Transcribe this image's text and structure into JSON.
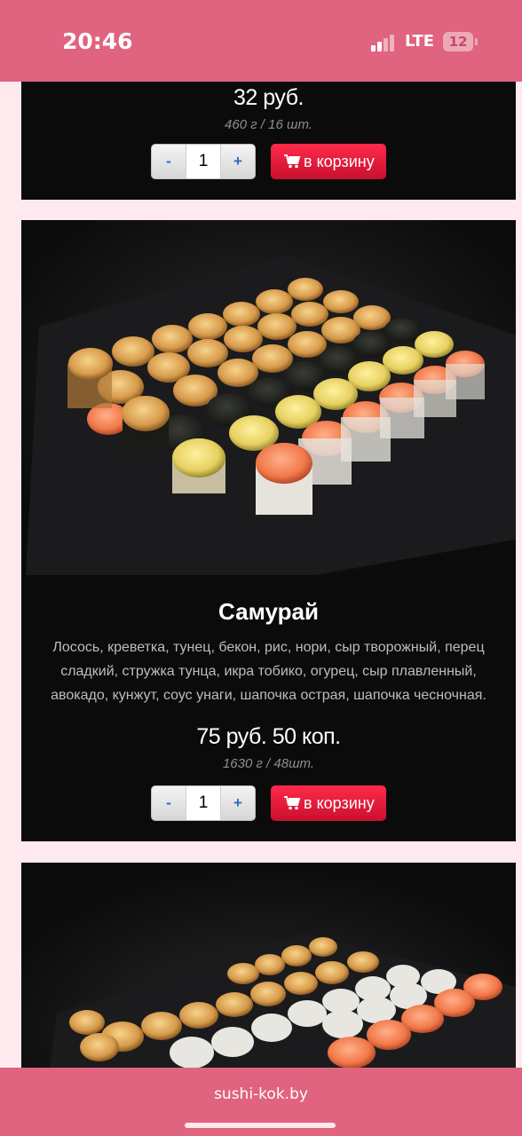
{
  "status": {
    "time": "20:46",
    "network": "LTE",
    "battery": "12"
  },
  "products": [
    {
      "price": "32 руб.",
      "weight": "460 г / 16 шт.",
      "qty": "1",
      "minus": "-",
      "plus": "+",
      "cart_label": "в корзину"
    },
    {
      "title": "Самурай",
      "description": "Лосось, креветка, тунец, бекон, рис, нори, сыр творожный, перец сладкий, стружка тунца, икра тобико, огурец, сыр плавленный, авокадо, кунжут, соус унаги, шапочка острая, шапочка чесночная.",
      "price": "75 руб. 50 коп.",
      "weight": "1630 г / 48шт.",
      "qty": "1",
      "minus": "-",
      "plus": "+",
      "cart_label": "в корзину"
    }
  ],
  "browser": {
    "url": "sushi-kok.by"
  },
  "colors": {
    "accent": "#e0637f",
    "cart_button": "#e8192c",
    "card_bg": "#0b0b0c",
    "page_bg": "#fde9ee"
  },
  "icons": {
    "cart": "cart-icon"
  }
}
